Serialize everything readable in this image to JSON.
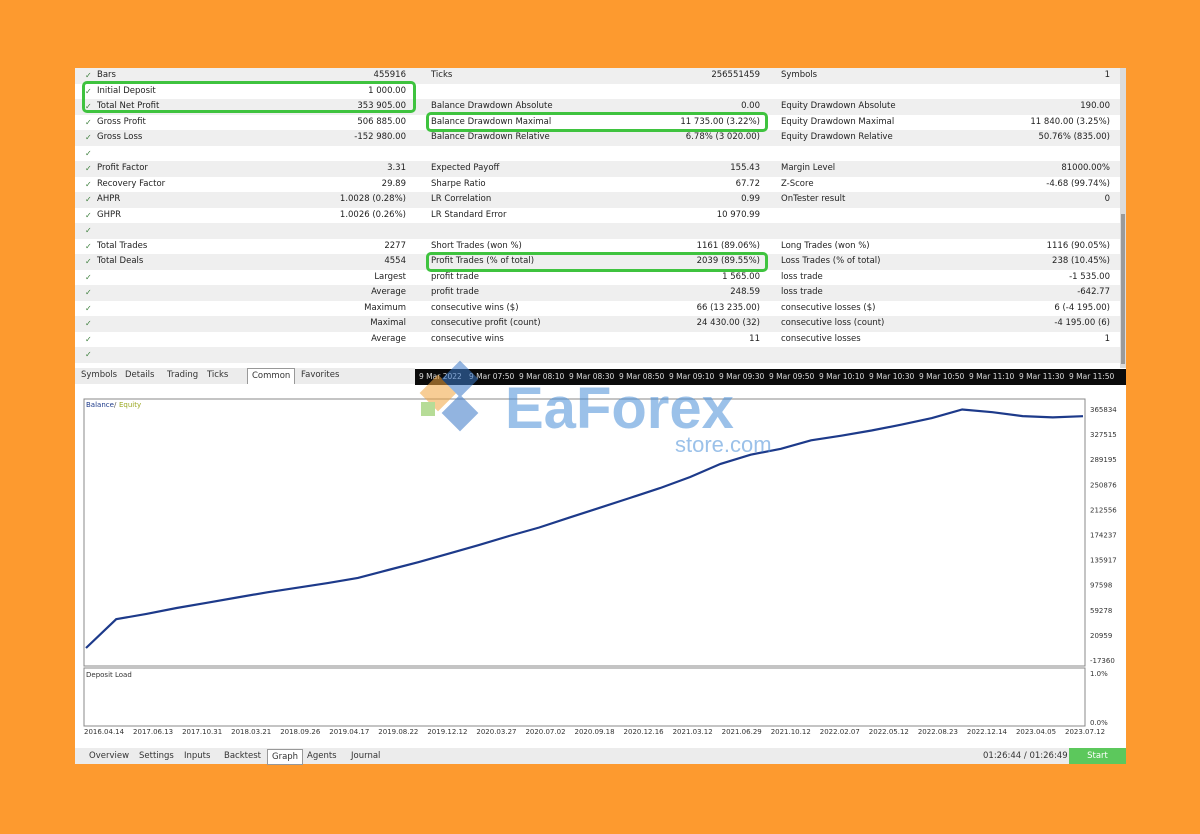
{
  "report": {
    "rows": [
      {
        "l1": "Bars",
        "v1": "455916",
        "l2": "Ticks",
        "v2": "256551459",
        "l3": "Symbols",
        "v3": "1"
      },
      {
        "l1": "Initial Deposit",
        "v1": "1 000.00",
        "l2": "",
        "v2": "",
        "l3": "",
        "v3": ""
      },
      {
        "l1": "Total Net Profit",
        "v1": "353 905.00",
        "l2": "Balance Drawdown Absolute",
        "v2": "0.00",
        "l3": "Equity Drawdown Absolute",
        "v3": "190.00"
      },
      {
        "l1": "Gross Profit",
        "v1": "506 885.00",
        "l2": "Balance Drawdown Maximal",
        "v2": "11 735.00 (3.22%)",
        "l3": "Equity Drawdown Maximal",
        "v3": "11 840.00 (3.25%)"
      },
      {
        "l1": "Gross Loss",
        "v1": "-152 980.00",
        "l2": "Balance Drawdown Relative",
        "v2": "6.78% (3 020.00)",
        "l3": "Equity Drawdown Relative",
        "v3": "50.76% (835.00)"
      },
      {
        "l1": "",
        "v1": "",
        "l2": "",
        "v2": "",
        "l3": "",
        "v3": ""
      },
      {
        "l1": "Profit Factor",
        "v1": "3.31",
        "l2": "Expected Payoff",
        "v2": "155.43",
        "l3": "Margin Level",
        "v3": "81000.00%"
      },
      {
        "l1": "Recovery Factor",
        "v1": "29.89",
        "l2": "Sharpe Ratio",
        "v2": "67.72",
        "l3": "Z-Score",
        "v3": "-4.68 (99.74%)"
      },
      {
        "l1": "AHPR",
        "v1": "1.0028 (0.28%)",
        "l2": "LR Correlation",
        "v2": "0.99",
        "l3": "OnTester result",
        "v3": "0"
      },
      {
        "l1": "GHPR",
        "v1": "1.0026 (0.26%)",
        "l2": "LR Standard Error",
        "v2": "10 970.99",
        "l3": "",
        "v3": ""
      },
      {
        "l1": "",
        "v1": "",
        "l2": "",
        "v2": "",
        "l3": "",
        "v3": ""
      },
      {
        "l1": "Total Trades",
        "v1": "2277",
        "l2": "Short Trades (won %)",
        "v2": "1161 (89.06%)",
        "l3": "Long Trades (won %)",
        "v3": "1116 (90.05%)"
      },
      {
        "l1": "Total Deals",
        "v1": "4554",
        "l2": "Profit Trades (% of total)",
        "v2": "2039 (89.55%)",
        "l3": "Loss Trades (% of total)",
        "v3": "238 (10.45%)"
      },
      {
        "l1": "",
        "v1": "Largest",
        "l2": "profit trade",
        "v2": "1 565.00",
        "l3": "loss trade",
        "v3": "-1 535.00"
      },
      {
        "l1": "",
        "v1": "Average",
        "l2": "profit trade",
        "v2": "248.59",
        "l3": "loss trade",
        "v3": "-642.77"
      },
      {
        "l1": "",
        "v1": "Maximum",
        "l2": "consecutive wins ($)",
        "v2": "66 (13 235.00)",
        "l3": "consecutive losses ($)",
        "v3": "6 (-4 195.00)"
      },
      {
        "l1": "",
        "v1": "Maximal",
        "l2": "consecutive profit (count)",
        "v2": "24 430.00 (32)",
        "l3": "consecutive loss (count)",
        "v3": "-4 195.00 (6)"
      },
      {
        "l1": "",
        "v1": "Average",
        "l2": "consecutive wins",
        "v2": "11",
        "l3": "consecutive losses",
        "v3": "1"
      },
      {
        "l1": "",
        "v1": "",
        "l2": "",
        "v2": "",
        "l3": "",
        "v3": ""
      }
    ]
  },
  "tabs": [
    "Symbols",
    "Details",
    "Trading",
    "Ticks",
    "Common",
    "Favorites"
  ],
  "active_tab": "Common",
  "timebar": [
    "9 Mar 2022",
    "9 Mar 07:50",
    "9 Mar 08:10",
    "9 Mar 08:30",
    "9 Mar 08:50",
    "9 Mar 09:10",
    "9 Mar 09:30",
    "9 Mar 09:50",
    "9 Mar 10:10",
    "9 Mar 10:30",
    "9 Mar 10:50",
    "9 Mar 11:10",
    "9 Mar 11:30",
    "9 Mar 11:50"
  ],
  "graph": {
    "legend_balance": "Balance",
    "legend_sep": "/",
    "legend_equity": "Equity",
    "sub_title": "Deposit Load",
    "sub_top": "1.0%",
    "sub_bottom": "0.0%"
  },
  "chart_data": {
    "type": "line",
    "series": [
      {
        "name": "Balance",
        "values": [
          1000,
          45000,
          53000,
          62000,
          70000,
          78000,
          86000,
          93000,
          100000,
          108000,
          120000,
          132000,
          145000,
          158000,
          172000,
          185000,
          200000,
          215000,
          230000,
          245000,
          262000,
          282000,
          296000,
          305000,
          318000,
          325000,
          333000,
          342000,
          352000,
          365000,
          361000,
          355000,
          353000,
          354905
        ]
      }
    ],
    "x": [
      "2016.04.14",
      "2017.06.13",
      "2017.10.31",
      "2018.03.21",
      "2018.09.26",
      "2019.04.17",
      "2019.08.22",
      "2019.12.12",
      "2020.03.27",
      "2020.07.02",
      "2020.09.18",
      "2020.12.16",
      "2021.03.12",
      "2021.06.29",
      "2021.10.12",
      "2022.02.07",
      "2022.05.12",
      "2022.08.23",
      "2022.12.14",
      "2023.04.05",
      "2023.07.12"
    ],
    "y_ticks": [
      "365834",
      "327515",
      "289195",
      "250876",
      "212556",
      "174237",
      "135917",
      "97598",
      "59278",
      "20959",
      "-17360"
    ],
    "ylim": [
      -17360,
      365834
    ],
    "colors": {
      "balance": "#1d3a8a",
      "equity": "#9aa820"
    }
  },
  "bottom_tabs": [
    "Overview",
    "Settings",
    "Inputs",
    "Backtest",
    "Graph",
    "Agents",
    "Journal"
  ],
  "active_bottom_tab": "Graph",
  "timer": "01:26:44 / 01:26:49",
  "start_label": "Start",
  "watermark": {
    "brand": "EaForex",
    "sub": "store.com"
  }
}
